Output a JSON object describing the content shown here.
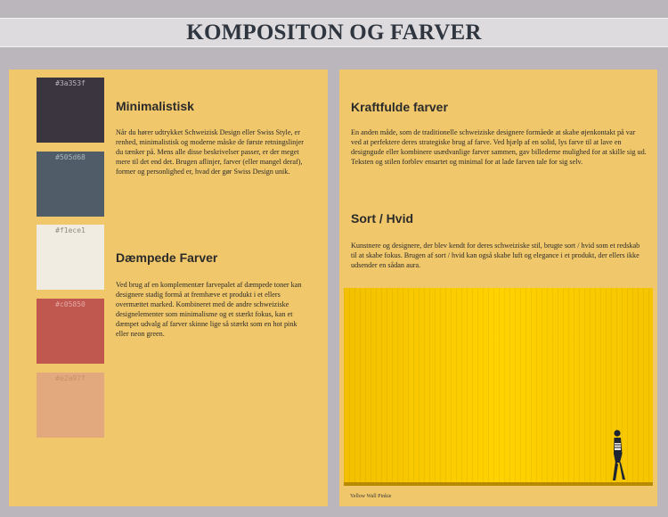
{
  "page_title": "KOMPOSITON OG FARVER",
  "swatches": [
    {
      "hex": "#3a353f",
      "color": "#3a353f",
      "label_color": "#b9b3c0"
    },
    {
      "hex": "#505d68",
      "color": "#505d68",
      "label_color": "#aeb6bd"
    },
    {
      "hex": "#f1ece1",
      "color": "#f1ece1",
      "label_color": "#8f8a80"
    },
    {
      "hex": "#c05850",
      "color": "#c05850",
      "label_color": "#e4a9a3"
    },
    {
      "hex": "#e2a97f",
      "color": "#e2a97f",
      "label_color": "#c98e66"
    }
  ],
  "sections": {
    "minimalistisk": {
      "heading": "Minimalistisk",
      "text": "Når du hører udtrykket Schweizisk Design eller Swiss Style, er renhed, minimalistisk og moderne måske de første retningslinjer du tænker på. Mens alle disse beskrivelser passer, er der meget mere til det end det. Brugen aflinjer, farver (eller mangel deraf), former og personlighed er, hvad der gør Swiss Design unik."
    },
    "daempede": {
      "heading": "Dæmpede Farver",
      "text": "Ved brug af en komplementær farvepalet af dæmpede toner kan designere stadig formå at fremhæve et produkt i et ellers overmættet marked. Kombineret med de andre schweiziske designelementer som minimalisme og et stærkt fokus, kan et dæmpet udvalg af farver skinne lige så stærkt som en hot pink eller neon green."
    },
    "kraftfulde": {
      "heading": "Kraftfulde farver",
      "text": "En anden måde, som de traditionelle schweiziske designere formåede at skabe øjenkontakt på var ved at perfektere deres strategiske brug af farve. Ved hjælp af en solid, lys farve til at lave en designgude eller kombinere usædvanlige farver sammen, gav billederne mulighed for at skille sig ud. Teksten og stilen forblev ensartet og minimal for at lade farven tale for sig selv."
    },
    "sorthvid": {
      "heading": "Sort / Hvid",
      "text": "Kunstnere og designere, der blev kendt for deres schweiziske stil, brugte sort / hvid som et redskab til at skabe fokus. Brugen af sort / hvid kan også skabe luft og elegance i et produkt, der ellers ikke udsender en sådan aura."
    }
  },
  "photo_caption": "Yellow Wall Pinkie"
}
